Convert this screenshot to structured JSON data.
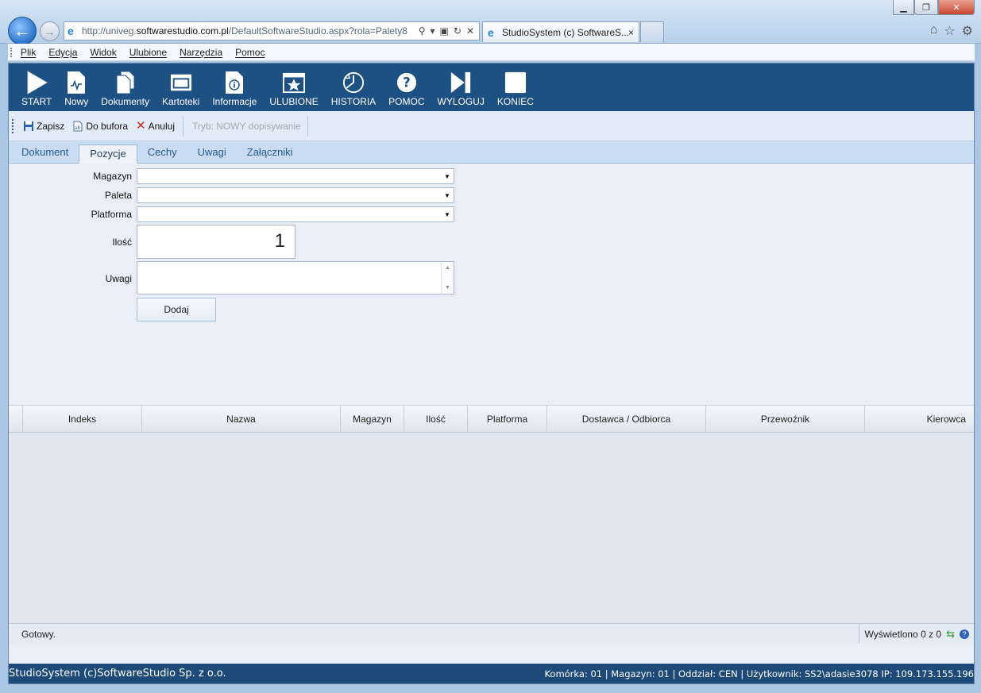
{
  "browser": {
    "url_prefix": "http://univeg.",
    "url_domain": "softwarestudio.com.pl",
    "url_path": "/DefaultSoftwareStudio.aspx?rola=Palety8",
    "tab_title": "StudioSystem (c) SoftwareS...",
    "tab_close": "×"
  },
  "menu": [
    "Plik",
    "Edycja",
    "Widok",
    "Ulubione",
    "Narzędzia",
    "Pomoc"
  ],
  "toolbar": [
    {
      "label": "START",
      "icon": "play-icon"
    },
    {
      "label": "Nowy",
      "icon": "new-document-icon"
    },
    {
      "label": "Dokumenty",
      "icon": "documents-icon"
    },
    {
      "label": "Kartoteki",
      "icon": "window-icon"
    },
    {
      "label": "Informacje",
      "icon": "info-icon"
    },
    {
      "label": "ULUBIONE",
      "icon": "star-icon"
    },
    {
      "label": "HISTORIA",
      "icon": "history-icon"
    },
    {
      "label": "POMOC",
      "icon": "help-icon"
    },
    {
      "label": "WYLOGUJ",
      "icon": "logout-icon"
    },
    {
      "label": "KONIEC",
      "icon": "stop-icon"
    }
  ],
  "commands": {
    "save": "Zapisz",
    "to_buffer": "Do bufora",
    "cancel": "Anuluj",
    "mode": "Tryb: NOWY dopisywanie"
  },
  "tabs": [
    "Dokument",
    "Pozycje",
    "Cechy",
    "Uwagi",
    "Załączniki"
  ],
  "active_tab": "Pozycje",
  "form": {
    "magazyn_label": "Magazyn",
    "paleta_label": "Paleta",
    "platforma_label": "Platforma",
    "ilosc_label": "Ilość",
    "ilosc_value": "1",
    "uwagi_label": "Uwagi",
    "add_button": "Dodaj"
  },
  "grid": {
    "columns": [
      "Indeks",
      "Nazwa",
      "Magazyn",
      "Ilość",
      "Platforma",
      "Dostawca / Odbiorca",
      "Przewoźnik",
      "Kierowca"
    ],
    "rows": []
  },
  "status": {
    "text": "Gotowy.",
    "count": "Wyświetlono 0 z 0"
  },
  "footer": {
    "left": "StudioSystem (c)SoftwareStudio Sp. z o.o.",
    "right": "Komórka: 01 | Magazyn: 01 | Oddział: CEN | Użytkownik: SS2\\adasie3078 IP: 109.173.155.196"
  },
  "colors": {
    "toolbar_bg": "#1d5183",
    "footer_bg": "#1d4a78",
    "tabs_bg": "#c9dcf1"
  }
}
